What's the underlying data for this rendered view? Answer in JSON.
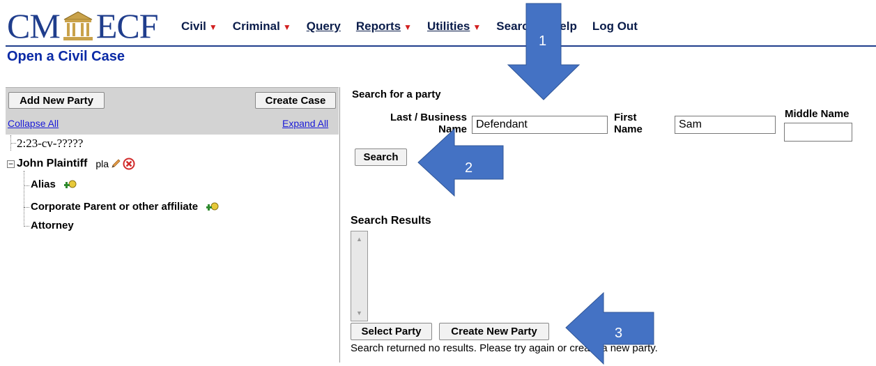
{
  "logo": {
    "left_text": "CM",
    "right_text": "ECF"
  },
  "menu": [
    {
      "label": "Civil",
      "has_caret": true
    },
    {
      "label": "Criminal",
      "has_caret": true
    },
    {
      "label": "Query",
      "has_caret": false
    },
    {
      "label": "Reports",
      "has_caret": true
    },
    {
      "label": "Utilities",
      "has_caret": true
    },
    {
      "label": "Search",
      "has_caret": false
    },
    {
      "label": "Help",
      "has_caret": false
    },
    {
      "label": "Log Out",
      "has_caret": false
    }
  ],
  "page_title": "Open a Civil Case",
  "left_panel": {
    "add_party_label": "Add New Party",
    "create_case_label": "Create Case",
    "collapse_all": "Collapse All",
    "expand_all": "Expand All",
    "case_number": "2:23-cv-?????",
    "party_name": "John Plaintiff",
    "party_role": "pla",
    "children": [
      "Alias",
      "Corporate Parent or other affiliate",
      "Attorney"
    ]
  },
  "search": {
    "heading": "Search for a party",
    "last_label_1": "Last / Business",
    "last_label_2": "Name",
    "last_value": "Defendant",
    "first_label_1": "First",
    "first_label_2": "Name",
    "first_value": "Sam",
    "middle_label": "Middle Name",
    "middle_value": "",
    "search_button": "Search"
  },
  "results": {
    "heading": "Search Results",
    "select_button": "Select Party",
    "create_button": "Create New Party",
    "status": "Search returned no results. Please try again or create a new party."
  },
  "annotations": [
    "1",
    "2",
    "3"
  ],
  "colors": {
    "brand": "#1f3d8c",
    "arrow": "#4472c4",
    "caret": "#d21f1f",
    "link": "#1a1ad8"
  }
}
